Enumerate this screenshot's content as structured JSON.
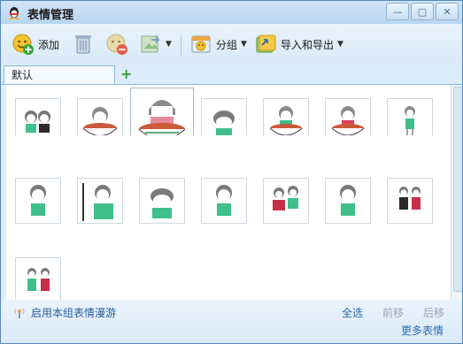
{
  "window": {
    "title": "表情管理"
  },
  "toolbar": {
    "add_label": "添加",
    "group_label": "分组",
    "import_export_label": "导入和导出"
  },
  "tabs": [
    {
      "label": "默认"
    }
  ],
  "colors": {
    "accent": "#2a69b2",
    "border": "#5a88b8",
    "toolbar": "#d9e9f8",
    "add_green": "#39a535"
  },
  "footer": {
    "roam_label": "启用本组表情漫游",
    "select_all": "全选",
    "move_forward": "前移",
    "move_back": "后移",
    "more_emoticons": "更多表情"
  }
}
